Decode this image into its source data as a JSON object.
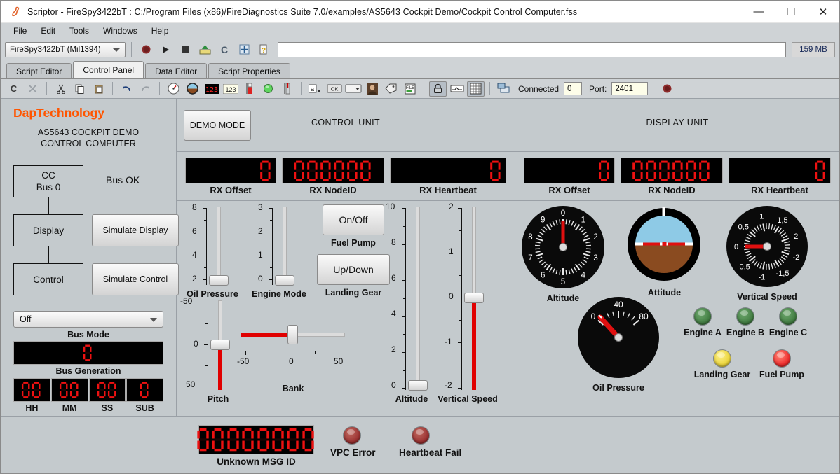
{
  "window": {
    "title": "Scriptor - FireSpy3422bT : C:/Program Files (x86)/FireDiagnostics Suite 7.0/examples/AS5643 Cockpit Demo/Cockpit Control Computer.fss",
    "app_icon": "scriptor-icon",
    "minimize": "—",
    "maximize": "☐",
    "close": "✕"
  },
  "menu": {
    "items": [
      "File",
      "Edit",
      "Tools",
      "Windows",
      "Help"
    ]
  },
  "devicebar": {
    "device": "FireSpy3422bT (Mil1394)",
    "buttons": [
      {
        "name": "record-button",
        "glyph": "record-icon"
      },
      {
        "name": "play-button",
        "glyph": "play-icon"
      },
      {
        "name": "stop-button",
        "glyph": "stop-icon"
      },
      {
        "name": "upload-button",
        "glyph": "upload-icon"
      },
      {
        "name": "compile-button",
        "glyph": "compile-c-icon"
      },
      {
        "name": "expand-button",
        "glyph": "expand-icon"
      },
      {
        "name": "script-help-button",
        "glyph": "script-help-icon"
      }
    ],
    "address_value": "",
    "memory": "159 MB"
  },
  "tabs": [
    {
      "label": "Script Editor",
      "active": false
    },
    {
      "label": "Control Panel",
      "active": true
    },
    {
      "label": "Data Editor",
      "active": false
    },
    {
      "label": "Script Properties",
      "active": false
    }
  ],
  "edit_toolbar": {
    "buttons": [
      {
        "name": "compile-button",
        "glyph": "C"
      },
      {
        "name": "delete-button",
        "glyph": "close-icon"
      },
      {
        "name": "cut-button",
        "glyph": "scissors-icon"
      },
      {
        "name": "copy-button",
        "glyph": "copy-icon"
      },
      {
        "name": "paste-button",
        "glyph": "paste-icon"
      },
      {
        "name": "undo-button",
        "glyph": "undo-icon"
      },
      {
        "name": "redo-button",
        "glyph": "redo-icon"
      },
      {
        "name": "add-gauge-button",
        "glyph": "gauge-icon"
      },
      {
        "name": "add-attitude-button",
        "glyph": "attitude-icon"
      },
      {
        "name": "add-seven-segment-button",
        "glyph": "seven-segment-icon"
      },
      {
        "name": "add-numeric-button",
        "glyph": "numeric-icon"
      },
      {
        "name": "add-slider-button",
        "glyph": "slider-icon"
      },
      {
        "name": "add-led-button",
        "glyph": "led-icon"
      },
      {
        "name": "add-vslider-button",
        "glyph": "vertical-slider-icon"
      },
      {
        "name": "add-textbox-button",
        "glyph": "textbox-icon"
      },
      {
        "name": "add-button-button",
        "glyph": "ok-button-icon"
      },
      {
        "name": "add-combobox-button",
        "glyph": "combobox-icon"
      },
      {
        "name": "add-image-button",
        "glyph": "image-icon"
      },
      {
        "name": "add-label-button",
        "glyph": "label-icon"
      },
      {
        "name": "add-file-button",
        "glyph": "file-icon"
      },
      {
        "name": "lock-button",
        "glyph": "lock-icon"
      },
      {
        "name": "graph-button",
        "glyph": "graph-icon"
      },
      {
        "name": "grid-button",
        "glyph": "grid-icon"
      },
      {
        "name": "network-button",
        "glyph": "network-icon"
      }
    ],
    "connected_label": "Connected",
    "connected_value": "0",
    "port_label": "Port:",
    "port_value": "2401",
    "status_led": "record-stop-icon"
  },
  "left_panel": {
    "brand": "DapTechnology",
    "subtitle_line1": "AS5643 COCKPIT DEMO",
    "subtitle_line2": "CONTROL COMPUTER",
    "cc_box_line1": "CC",
    "cc_box_line2": "Bus 0",
    "bus_status": "Bus OK",
    "display_box": "Display",
    "simulate_display": "Simulate Display",
    "control_box": "Control",
    "simulate_control": "Simulate Control",
    "bus_mode_value": "Off",
    "bus_mode_label": "Bus Mode",
    "bus_generation_value": "0",
    "bus_generation_label": "Bus Generation",
    "time_fields": [
      {
        "value": "00",
        "label": "HH",
        "digits": 2
      },
      {
        "value": "00",
        "label": "MM",
        "digits": 2
      },
      {
        "value": "00",
        "label": "SS",
        "digits": 2
      },
      {
        "value": "0",
        "label": "SUB",
        "digits": 1
      }
    ]
  },
  "control_unit": {
    "title": "CONTROL UNIT",
    "demo_mode": "DEMO MODE",
    "rx": [
      {
        "label": "RX Offset",
        "value": "0",
        "width": 1
      },
      {
        "label": "RX NodeID",
        "value": "000000",
        "width": 6
      },
      {
        "label": "RX Heartbeat",
        "value": "0",
        "width": 1
      }
    ],
    "sliders": [
      {
        "name": "oil-pressure",
        "label": "Oil Pressure",
        "orient": "v",
        "min": 1,
        "max": 8,
        "value": 1,
        "ticks": [
          2,
          4,
          6,
          8
        ],
        "tick_labels": [
          "2",
          "4",
          "6",
          "8"
        ],
        "fill": false
      },
      {
        "name": "engine-mode",
        "label": "Engine Mode",
        "orient": "v",
        "min": 0,
        "max": 3,
        "value": 0,
        "ticks": [
          0,
          1,
          2,
          3
        ],
        "tick_labels": [
          "0",
          "1",
          "2",
          "3"
        ],
        "fill": false
      },
      {
        "name": "pitch",
        "label": "Pitch",
        "orient": "v",
        "min": -75,
        "max": 75,
        "value": 0,
        "ticks": [
          -50,
          0,
          50
        ],
        "tick_labels": [
          "-50",
          "0",
          "50"
        ],
        "fill": true
      },
      {
        "name": "altitude",
        "label": "Altitude",
        "orient": "v",
        "min": 0,
        "max": 10,
        "value": 0,
        "ticks": [
          0,
          2,
          4,
          6,
          8,
          10
        ],
        "tick_labels": [
          "0",
          "2",
          "4",
          "6",
          "8",
          "10"
        ],
        "fill": false
      },
      {
        "name": "vertical-speed",
        "label": "Vertical Speed",
        "orient": "v",
        "min": -2,
        "max": 2,
        "value": 0,
        "ticks": [
          -2,
          -1,
          0,
          1,
          2
        ],
        "tick_labels": [
          "-2",
          "-1",
          "0",
          "1",
          "2"
        ],
        "fill": true
      },
      {
        "name": "bank",
        "label": "Bank",
        "orient": "h",
        "min": -75,
        "max": 75,
        "value": 0,
        "ticks": [
          -50,
          0,
          50
        ],
        "tick_labels": [
          "-50",
          "0",
          "50"
        ],
        "fill": true
      }
    ],
    "buttons": [
      {
        "name": "fuel-pump",
        "text": "On/Off",
        "caption": "Fuel Pump"
      },
      {
        "name": "landing-gear",
        "text": "Up/Down",
        "caption": "Landing Gear"
      }
    ]
  },
  "display_unit": {
    "title": "DISPLAY UNIT",
    "rx": [
      {
        "label": "RX Offset",
        "value": "0",
        "width": 1
      },
      {
        "label": "RX NodeID",
        "value": "000000",
        "width": 6
      },
      {
        "label": "RX Heartbeat",
        "value": "0",
        "width": 1
      }
    ],
    "gauges": [
      {
        "name": "altitude-gauge",
        "label": "Altitude",
        "type": "dial",
        "labels": [
          "0",
          "1",
          "2",
          "3",
          "4",
          "5",
          "6",
          "7",
          "8",
          "9"
        ],
        "value": 0,
        "needle_angle": 0
      },
      {
        "name": "attitude-indicator",
        "label": "Attitude",
        "type": "attitude",
        "pitch": 0,
        "bank": 0,
        "sky_color": "#8ecae6",
        "ground_color": "#8a4b20"
      },
      {
        "name": "vertical-speed-gauge",
        "label": "Vertical Speed",
        "type": "dial",
        "labels": [
          "0",
          "0,5",
          "1",
          "1,5",
          "2",
          "-2",
          "-1,5",
          "-1",
          "-0,5"
        ],
        "value": 0,
        "needle_angle": -90
      },
      {
        "name": "oil-pressure-gauge",
        "label": "Oil Pressure",
        "type": "arc",
        "labels": [
          "0",
          "40",
          "80"
        ],
        "value": 0,
        "needle_angle": -140
      }
    ],
    "leds": [
      {
        "name": "engine-a-led",
        "label": "Engine A",
        "color": "#4a8a4a",
        "on": false
      },
      {
        "name": "engine-b-led",
        "label": "Engine B",
        "color": "#4a8a4a",
        "on": false
      },
      {
        "name": "engine-c-led",
        "label": "Engine C",
        "color": "#4a8a4a",
        "on": false
      },
      {
        "name": "landing-gear-led",
        "label": "Landing Gear",
        "color": "#f0dd44",
        "on": true
      },
      {
        "name": "fuel-pump-led",
        "label": "Fuel Pump",
        "color": "#f03030",
        "on": true
      }
    ]
  },
  "status_bar": {
    "msg_id_value": "00000000",
    "msg_id_label": "Unknown MSG ID",
    "leds": [
      {
        "name": "vpc-error-led",
        "label": "VPC Error",
        "color": "#a03030",
        "on": false
      },
      {
        "name": "heartbeat-fail-led",
        "label": "Heartbeat Fail",
        "color": "#a03030",
        "on": false
      }
    ]
  },
  "colors": {
    "brand_orange": "#ff5500",
    "panel_gray": "#c4cacd",
    "seg_red": "#ee1111",
    "slider_red": "#e00000"
  }
}
